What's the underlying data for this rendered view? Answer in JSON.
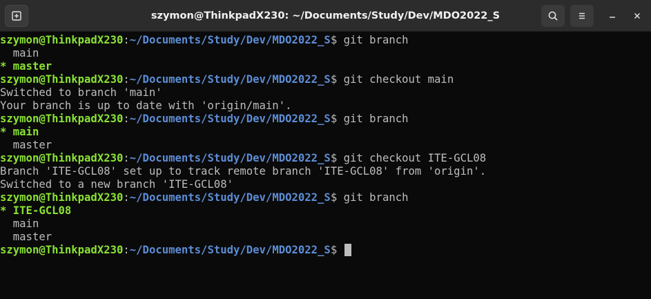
{
  "window": {
    "title": "szymon@ThinkpadX230: ~/Documents/Study/Dev/MDO2022_S"
  },
  "icons": {
    "new_tab": "new-tab-icon",
    "search": "search-icon",
    "menu": "hamburger-menu-icon",
    "minimize": "minimize-icon",
    "close": "close-icon"
  },
  "colors": {
    "prompt_user": "#8ae234",
    "prompt_path": "#5c8dd6",
    "text": "#bdbdbd",
    "background": "#0a0a0a",
    "titlebar": "#2c2c2c"
  },
  "prompt": {
    "user": "szymon@ThinkpadX230",
    "sep": ":",
    "path": "~/Documents/Study/Dev/MDO2022_S",
    "symbol": "$"
  },
  "terminal": {
    "lines": [
      {
        "type": "prompt",
        "cmd": "git branch"
      },
      {
        "type": "branch",
        "text": "  main"
      },
      {
        "type": "current",
        "text": "* master"
      },
      {
        "type": "prompt",
        "cmd": "git checkout main"
      },
      {
        "type": "output",
        "text": "Switched to branch 'main'"
      },
      {
        "type": "output",
        "text": "Your branch is up to date with 'origin/main'."
      },
      {
        "type": "prompt",
        "cmd": "git branch"
      },
      {
        "type": "current",
        "text": "* main"
      },
      {
        "type": "branch",
        "text": "  master"
      },
      {
        "type": "prompt",
        "cmd": "git checkout ITE-GCL08"
      },
      {
        "type": "output",
        "text": "Branch 'ITE-GCL08' set up to track remote branch 'ITE-GCL08' from 'origin'."
      },
      {
        "type": "output",
        "text": "Switched to a new branch 'ITE-GCL08'"
      },
      {
        "type": "prompt",
        "cmd": "git branch"
      },
      {
        "type": "current",
        "text": "* ITE-GCL08"
      },
      {
        "type": "branch",
        "text": "  main"
      },
      {
        "type": "branch",
        "text": "  master"
      },
      {
        "type": "prompt-active",
        "cmd": ""
      }
    ]
  }
}
